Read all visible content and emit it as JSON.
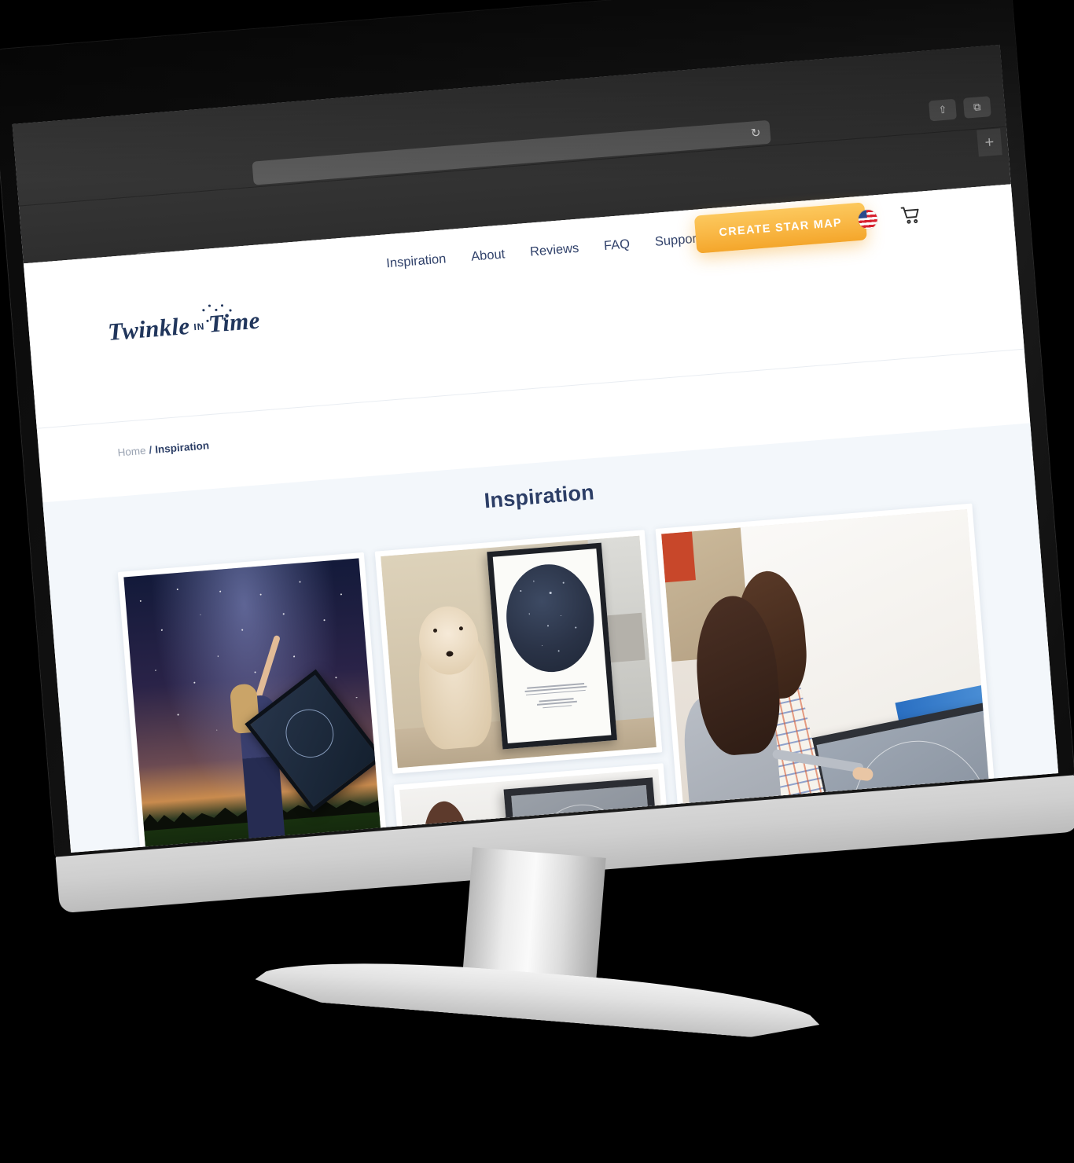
{
  "browser": {
    "window_controls": [
      "close",
      "minimize",
      "zoom"
    ],
    "back_label": "‹",
    "forward_label": "›",
    "sidebar_icon": "sidebar-icon",
    "address_value": "",
    "address_placeholder": "",
    "reload_icon": "↻",
    "share_icon": "⇧",
    "tabs_icon": "⧉",
    "new_tab_label": "+"
  },
  "site": {
    "logo": {
      "word1": "Twinkle",
      "middle": "IN",
      "word2": "Time"
    },
    "nav": [
      {
        "label": "Inspiration"
      },
      {
        "label": "About"
      },
      {
        "label": "Reviews"
      },
      {
        "label": "FAQ"
      },
      {
        "label": "Support"
      }
    ],
    "cta_label": "CREATE STAR MAP",
    "locale_icon": "us-flag-icon",
    "cart_icon": "shopping-cart-icon",
    "accent_color": "#f4a62b",
    "brand_color": "#2c3e66"
  },
  "breadcrumb": {
    "home": "Home",
    "separator": "/",
    "current": "Inspiration"
  },
  "main": {
    "title": "Inspiration",
    "gallery": [
      {
        "name": "woman-pointing-at-milky-way-holding-star-map"
      },
      {
        "name": "dog-next-to-framed-star-map-poster"
      },
      {
        "name": "family-touching-framed-star-map"
      },
      {
        "name": "two-women-on-bed-pointing-at-star-map"
      }
    ]
  }
}
